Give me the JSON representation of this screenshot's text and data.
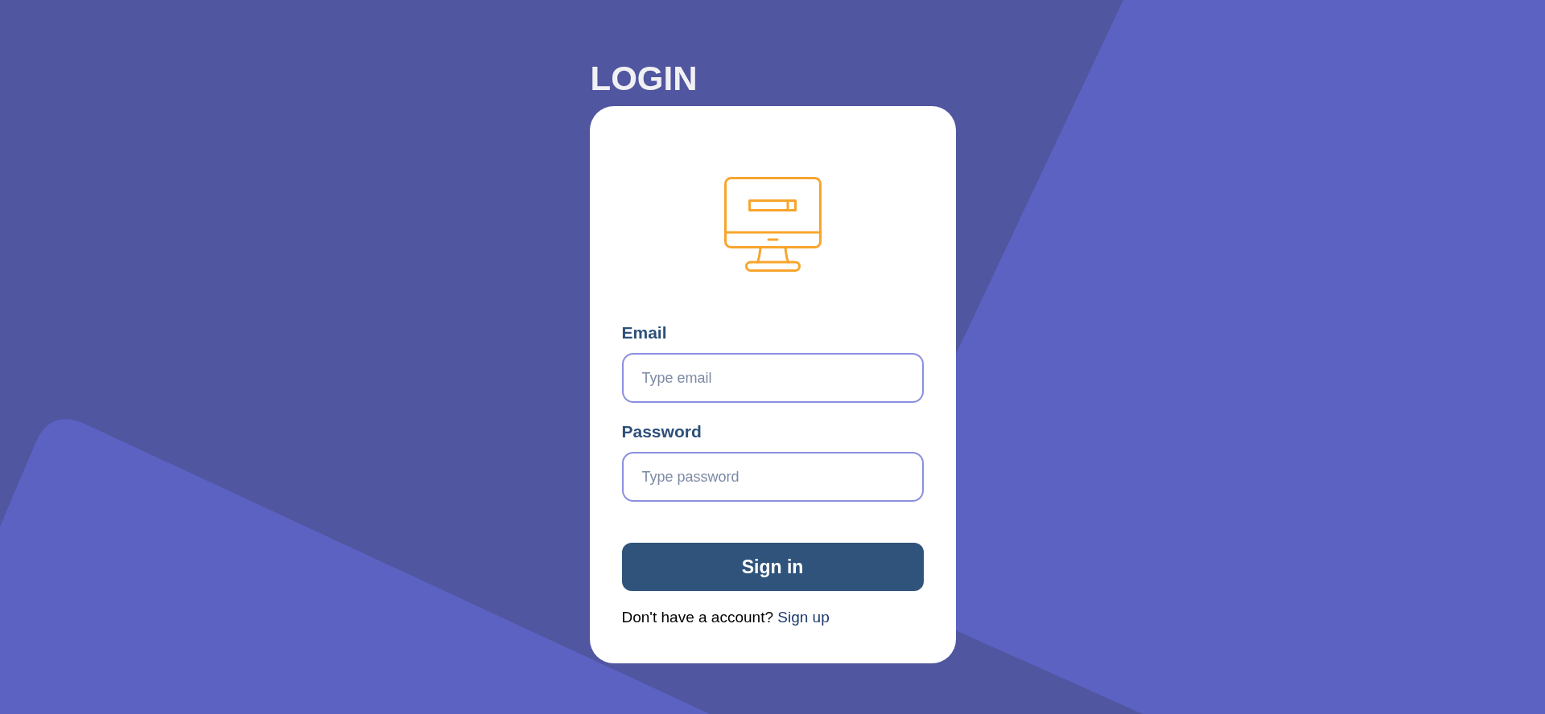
{
  "heading": "LOGIN",
  "fields": [
    {
      "label": "Email",
      "placeholder": "Type email"
    },
    {
      "label": "Password",
      "placeholder": "Type password"
    }
  ],
  "submit_button": "Sign in",
  "signup_prompt": {
    "text": "Don't have a account?",
    "link": "Sign up"
  }
}
